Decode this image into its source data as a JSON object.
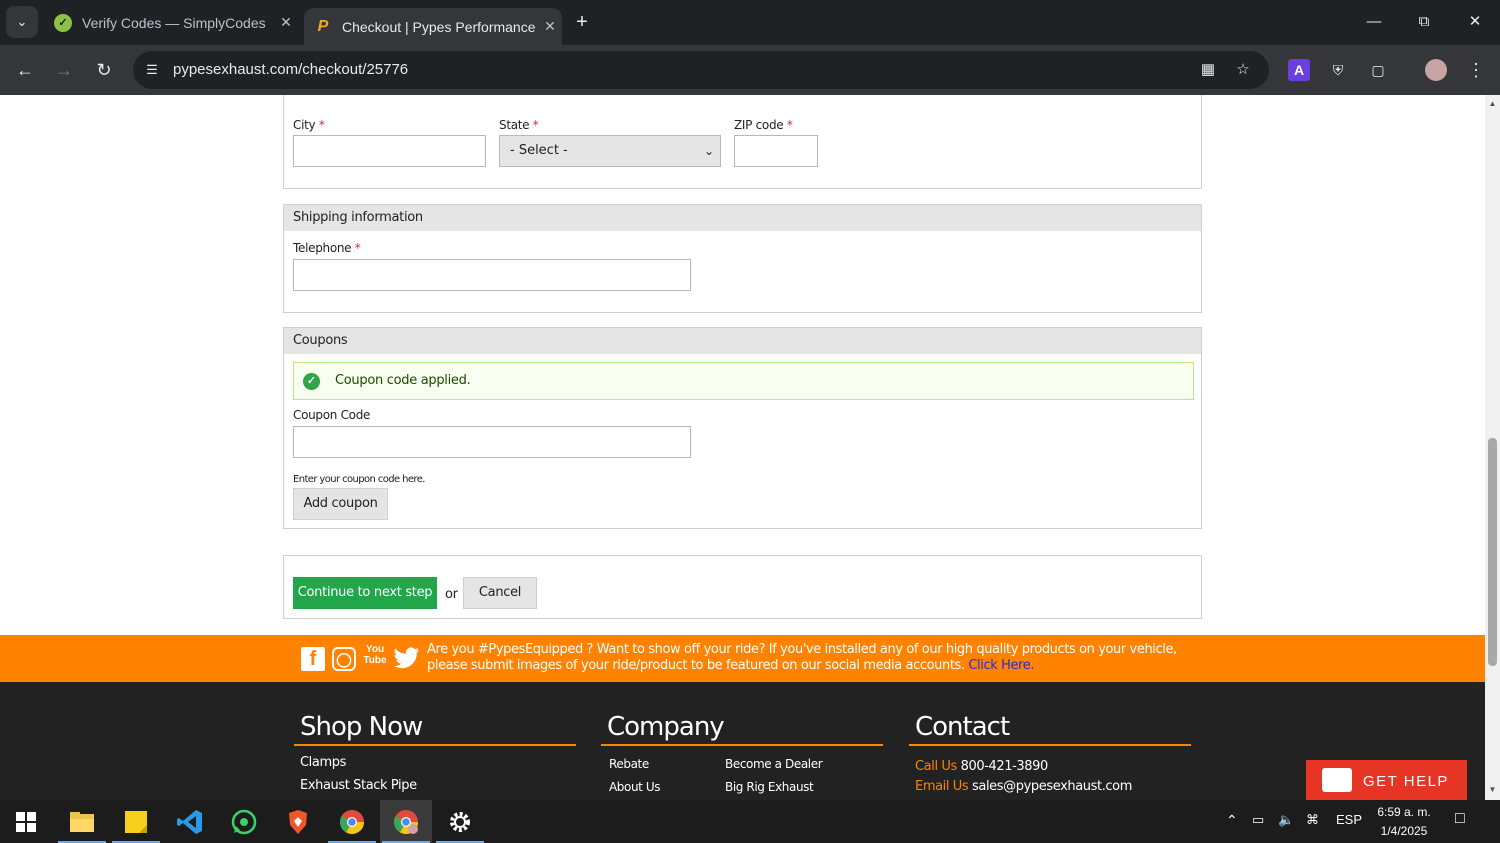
{
  "browser": {
    "tabs": [
      {
        "title": "Verify Codes — SimplyCodes",
        "active": false
      },
      {
        "title": "Checkout | Pypes Performance E",
        "active": true
      }
    ],
    "url": "pypesexhaust.com/checkout/25776"
  },
  "address_form": {
    "city_label": "City",
    "state_label": "State",
    "state_value": "- Select -",
    "zip_label": "ZIP code",
    "required_mark": "*"
  },
  "shipping": {
    "heading": "Shipping information",
    "telephone_label": "Telephone"
  },
  "coupons": {
    "heading": "Coupons",
    "message": "Coupon code applied.",
    "coupon_label": "Coupon Code",
    "help_text": "Enter your coupon code here.",
    "add_button": "Add coupon"
  },
  "actions": {
    "continue_button": "Continue to next step",
    "or_text": "or",
    "cancel_button": "Cancel"
  },
  "social_banner": {
    "youtube_text": "You Tube",
    "text": "Are you #PypesEquipped ? Want to show off your ride? If you've installed any of our high quality products on your vehicle, please submit images of your ride/product to be featured on our social media accounts.",
    "link": "Click Here."
  },
  "footer": {
    "shop": {
      "title": "Shop Now",
      "links": [
        "Clamps",
        "Exhaust Stack Pipe"
      ]
    },
    "company": {
      "title": "Company",
      "links": [
        "Rebate",
        "About Us"
      ],
      "links_col2": [
        "Become a Dealer",
        "Big Rig Exhaust"
      ]
    },
    "contact": {
      "title": "Contact",
      "call_label": "Call Us",
      "phone": "800-421-3890",
      "email_label": "Email Us",
      "email": "sales@pypesexhaust.com"
    }
  },
  "get_help": "GET HELP",
  "taskbar": {
    "language": "ESP",
    "time": "6:59 a. m.",
    "date": "1/4/2025"
  },
  "colors": {
    "accent_orange": "#ff8200",
    "continue_green": "#23a64a",
    "success_bg": "#f8fff0",
    "gethelp_red": "#e73525"
  }
}
